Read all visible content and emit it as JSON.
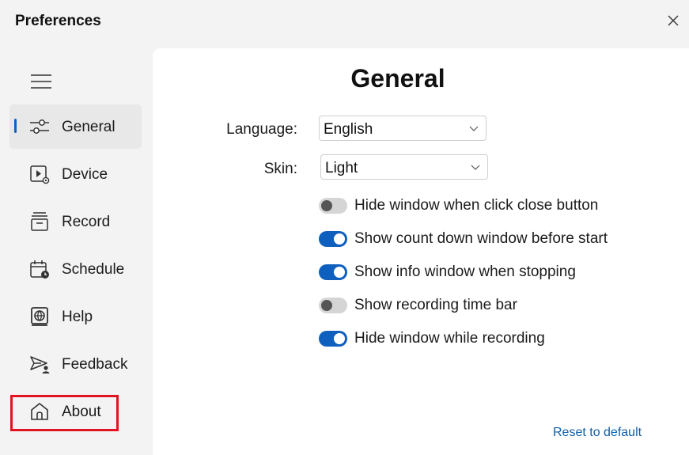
{
  "window": {
    "title": "Preferences"
  },
  "sidebar": {
    "items": [
      {
        "key": "general",
        "label": "General",
        "icon": "sliders-icon",
        "active": true
      },
      {
        "key": "device",
        "label": "Device",
        "icon": "device-icon",
        "active": false
      },
      {
        "key": "record",
        "label": "Record",
        "icon": "record-tray-icon",
        "active": false
      },
      {
        "key": "schedule",
        "label": "Schedule",
        "icon": "calendar-clock-icon",
        "active": false
      },
      {
        "key": "help",
        "label": "Help",
        "icon": "help-globe-icon",
        "active": false
      },
      {
        "key": "feedback",
        "label": "Feedback",
        "icon": "feedback-send-icon",
        "active": false
      },
      {
        "key": "about",
        "label": "About",
        "icon": "home-icon",
        "active": false
      }
    ]
  },
  "main": {
    "heading": "General",
    "language": {
      "label": "Language:",
      "value": "English"
    },
    "skin": {
      "label": "Skin:",
      "value": "Light"
    },
    "toggles": [
      {
        "label": "Hide window when click close button",
        "on": false
      },
      {
        "label": "Show count down window before start",
        "on": true
      },
      {
        "label": "Show info window when stopping",
        "on": true
      },
      {
        "label": "Show recording time bar",
        "on": false
      },
      {
        "label": "Hide window while recording",
        "on": true
      }
    ],
    "reset_label": "Reset to default"
  },
  "colors": {
    "accent": "#0f5fbf",
    "highlight_border": "#e0141f",
    "link": "#0f5fa8"
  }
}
